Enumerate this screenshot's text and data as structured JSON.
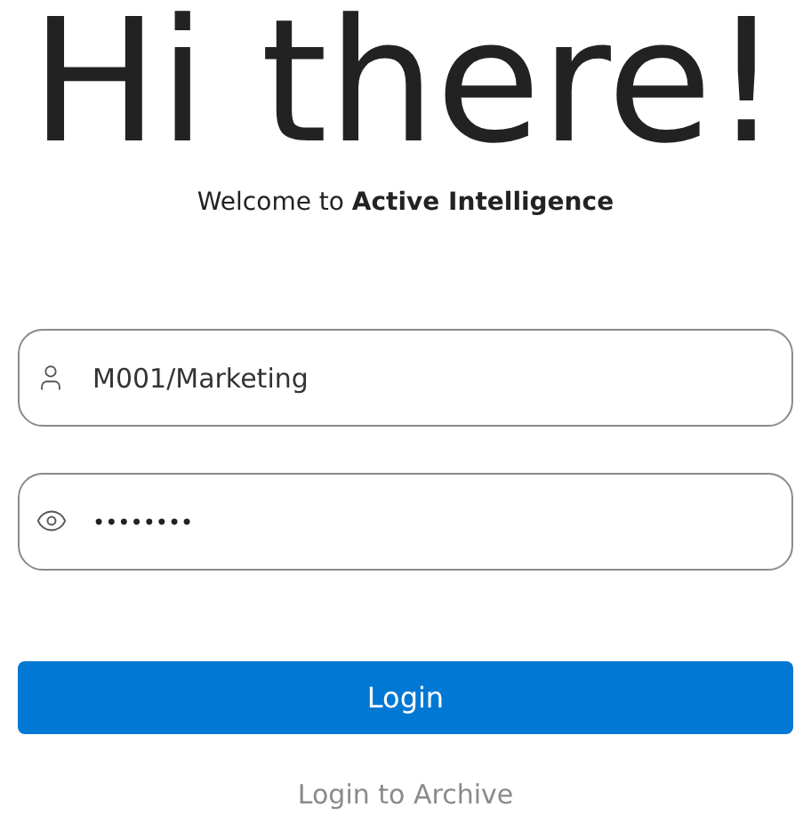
{
  "heading": "Hi there!",
  "welcome": "Welcome to **Active Intelligence**",
  "username": {
    "value": "M001/Marketing"
  },
  "password": {
    "value": "••••••••"
  },
  "login_button": "Login",
  "archive_link": "Login to Archive"
}
